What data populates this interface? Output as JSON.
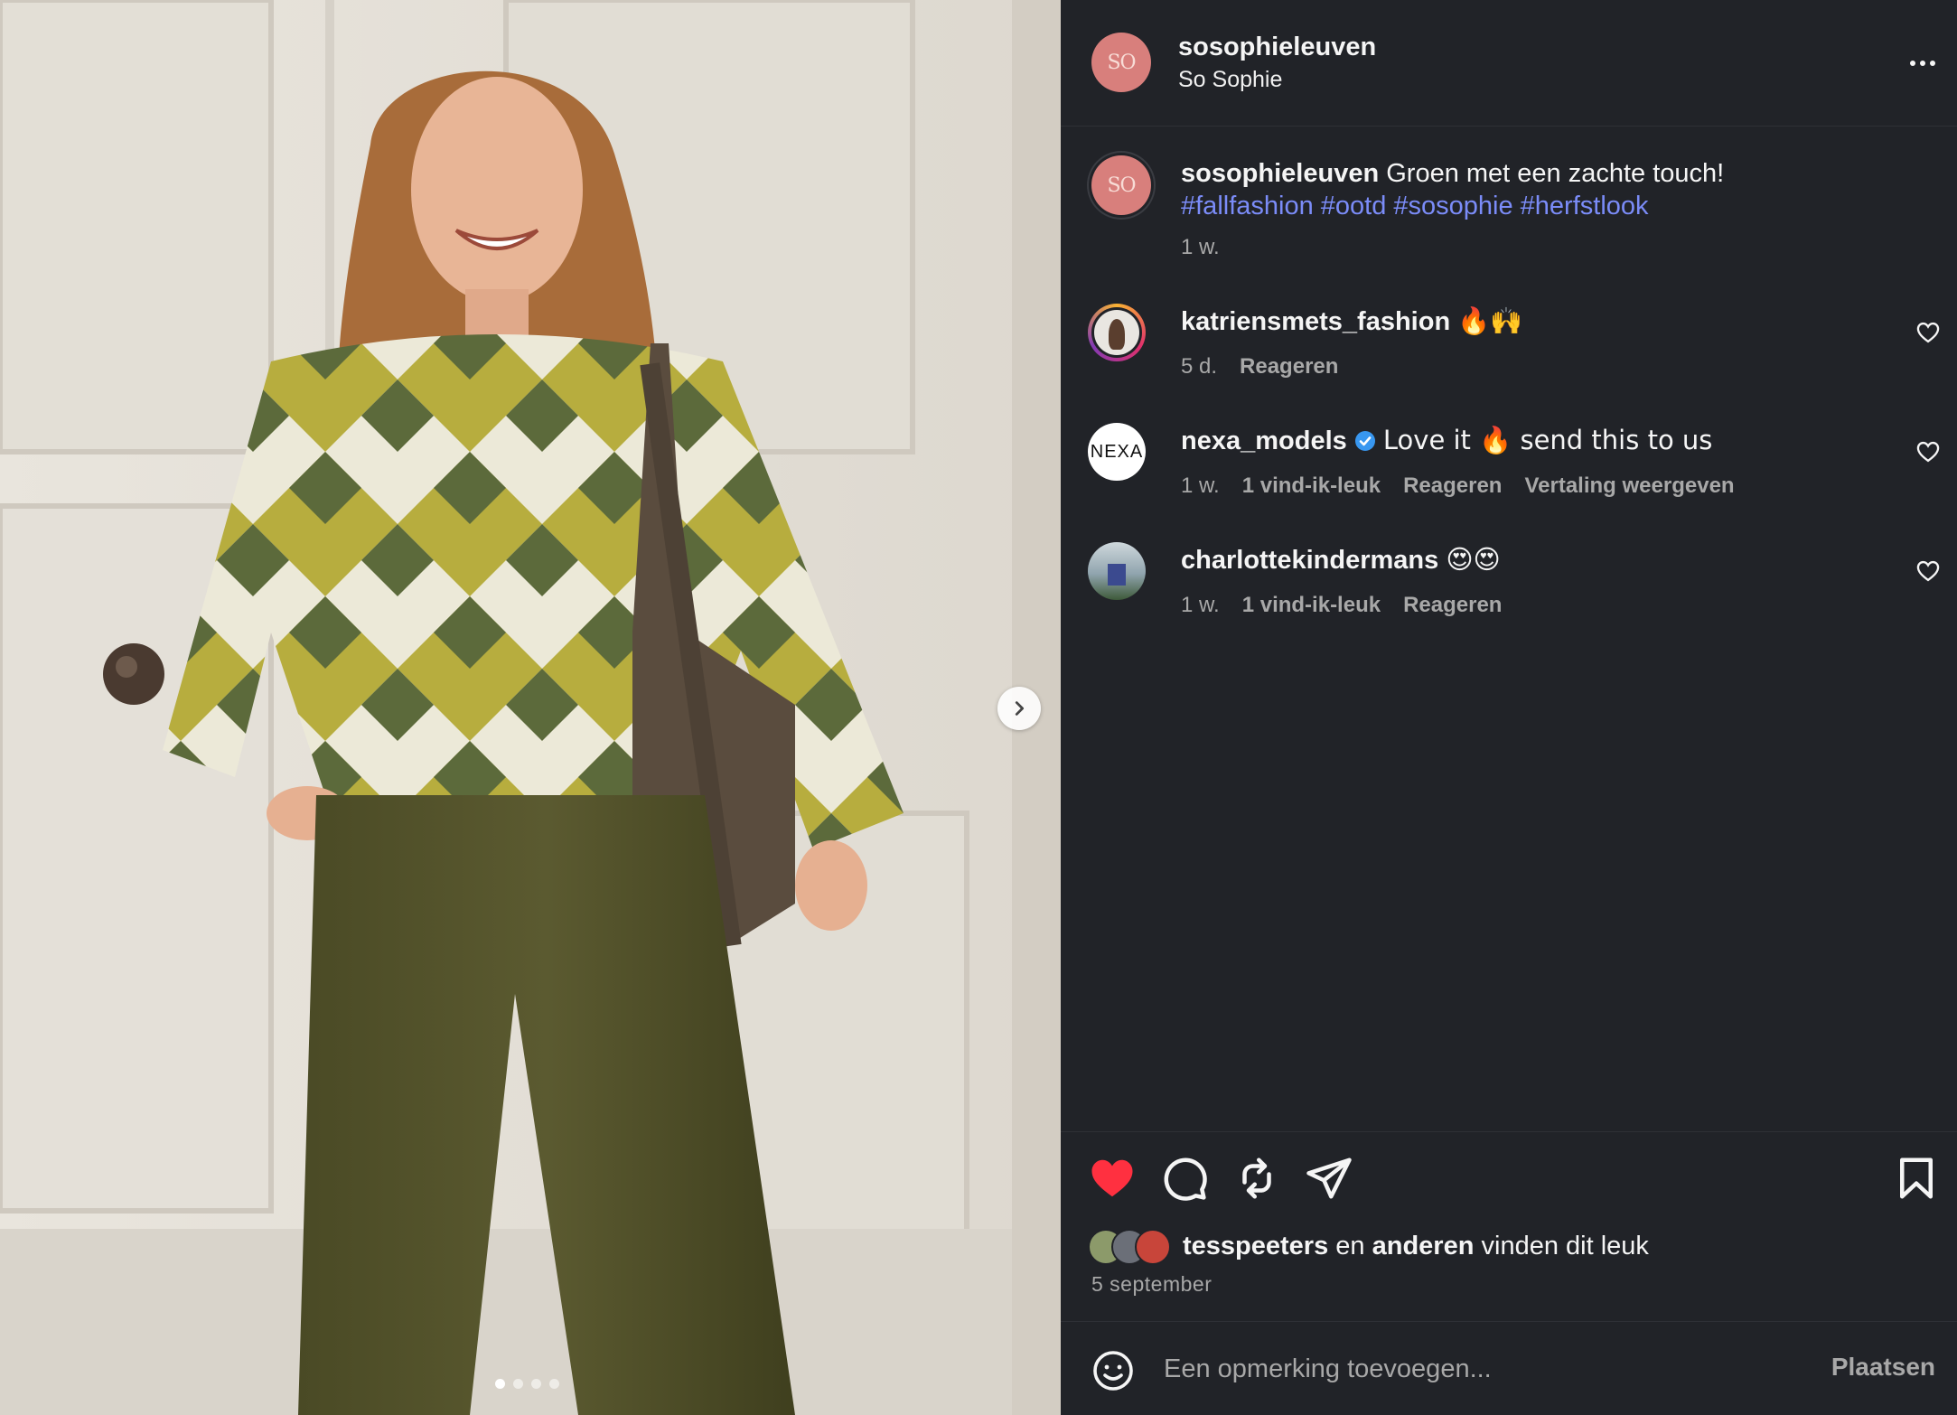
{
  "post": {
    "username": "sosophieleuven",
    "subtitle": "So Sophie",
    "avatar_text": "SO",
    "image_count": 4,
    "active_image": 1
  },
  "caption": {
    "username": "sosophieleuven",
    "text": "Groen met een zachte touch!",
    "hashtags": "#fallfashion #ootd #sosophie #herfstlook",
    "time": "1 w."
  },
  "comments": [
    {
      "username": "katriensmets_fashion",
      "text": "🔥🙌",
      "time": "5 d.",
      "likes": "",
      "reply": "Reageren",
      "translate": ""
    },
    {
      "username": "nexa_models",
      "text": "Love it 🔥 send this to us",
      "time": "1 w.",
      "likes": "1 vind-ik-leuk",
      "reply": "Reageren",
      "translate": "Vertaling weergeven",
      "avatar_text": "NEXA"
    },
    {
      "username": "charlottekindermans",
      "text": "😍😍",
      "time": "1 w.",
      "likes": "1 vind-ik-leuk",
      "reply": "Reageren",
      "translate": ""
    }
  ],
  "likes": {
    "first_user": "tesspeeters",
    "connector": "en",
    "others": "anderen",
    "suffix": "vinden dit leuk"
  },
  "date": "5 september",
  "comment_box": {
    "placeholder": "Een opmerking toevoegen...",
    "post_label": "Plaatsen"
  },
  "colors": {
    "background": "#212328",
    "hashtag": "#7b8cf8",
    "like_red": "#ff3040",
    "verified_blue": "#3897f0",
    "avatar_pink": "#d87f7c"
  },
  "icons": [
    "heart-filled-icon",
    "comment-icon",
    "repost-icon",
    "share-icon",
    "bookmark-icon",
    "emoji-icon",
    "chevron-right-icon",
    "more-icon",
    "heart-outline-icon",
    "verified-icon"
  ]
}
